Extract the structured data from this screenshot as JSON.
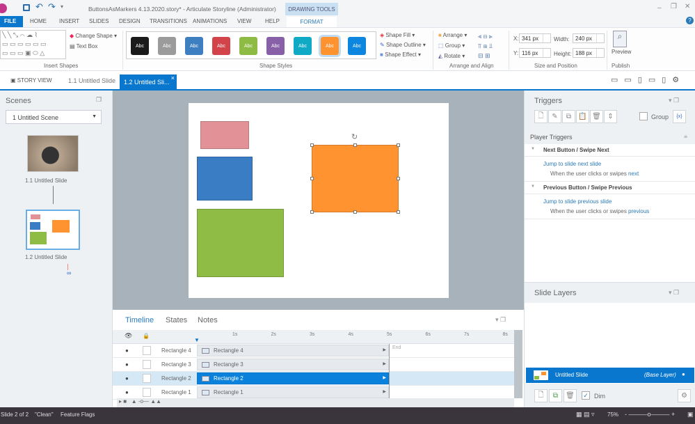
{
  "app": {
    "title": "ButtonsAsMarkers 4.13.2020.story* -  Articulate Storyline (Administrator)",
    "logo": "SL",
    "contextual_group": "DRAWING TOOLS"
  },
  "menu_tabs": [
    "FILE",
    "HOME",
    "INSERT",
    "SLIDES",
    "DESIGN",
    "TRANSITIONS",
    "ANIMATIONS",
    "VIEW",
    "HELP",
    "FORMAT"
  ],
  "ribbon": {
    "insert_shapes": {
      "label": "Insert Shapes",
      "change_shape": "Change Shape",
      "text_box": "Text Box"
    },
    "shape_styles": {
      "label": "Shape Styles",
      "style_text": "Abc",
      "colors": [
        "#1a1a1a",
        "#9b9b9b",
        "#3d7fc1",
        "#d2434a",
        "#8dbb43",
        "#8760a8",
        "#10a9c6",
        "#ff9330",
        "#0d86e0"
      ],
      "selected_index": 7,
      "shape_fill": "Shape Fill",
      "shape_outline": "Shape Outline",
      "shape_effect": "Shape Effect"
    },
    "arrange": {
      "label": "Arrange and Align",
      "arrange": "Arrange",
      "group": "Group",
      "rotate": "Rotate"
    },
    "size_position": {
      "label": "Size and Position",
      "x_label": "X:",
      "x": "341 px",
      "y_label": "Y:",
      "y": "116 px",
      "width_label": "Width:",
      "width": "240 px",
      "height_label": "Height:",
      "height": "188 px"
    },
    "publish": {
      "label": "Publish",
      "preview": "Preview"
    }
  },
  "doc_tabs": {
    "story_view": "STORY VIEW",
    "tabs": [
      "1.1 Untitled Slide",
      "1.2 Untitled Sli..."
    ],
    "active": 1,
    "close": "×"
  },
  "scenes": {
    "title": "Scenes",
    "selected_scene": "1 Untitled Scene",
    "slides": [
      "1.1 Untitled Slide",
      "1.2 Untitled Slide"
    ]
  },
  "slide_shapes": [
    {
      "name": "Rectangle 4",
      "color": "#e29296"
    },
    {
      "name": "Rectangle 3",
      "color": "#3b7dc4"
    },
    {
      "name": "Rectangle 1",
      "color": "#8fbc45"
    },
    {
      "name": "Rectangle 2",
      "color": "#ff9330"
    }
  ],
  "timeline": {
    "tabs": [
      "Timeline",
      "States",
      "Notes"
    ],
    "ticks": [
      "1s",
      "2s",
      "3s",
      "4s",
      "5s",
      "6s",
      "7s",
      "8s"
    ],
    "end_label": "End",
    "rows": [
      {
        "name": "Rectangle 4"
      },
      {
        "name": "Rectangle 3"
      },
      {
        "name": "Rectangle 2",
        "selected": true
      },
      {
        "name": "Rectangle 1"
      }
    ]
  },
  "triggers": {
    "title": "Triggers",
    "group_label": "Group",
    "player_triggers": "Player Triggers",
    "items": [
      {
        "header": "Next Button / Swipe Next",
        "action_prefix": "Jump to slide ",
        "action_target": "next slide",
        "condition_prefix": "When the user clicks or swipes ",
        "condition_target": "next"
      },
      {
        "header": "Previous Button / Swipe Previous",
        "action_prefix": "Jump to slide ",
        "action_target": "previous slide",
        "condition_prefix": "When the user clicks or swipes ",
        "condition_target": "previous"
      }
    ]
  },
  "layers": {
    "title": "Slide Layers",
    "base_name": "Untitled Slide",
    "base_tag": "(Base Layer)",
    "dim_label": "Dim",
    "dim_checked": true
  },
  "status": {
    "slide": "Slide 2 of 2",
    "theme": "\"Clean\"",
    "flags": "Feature Flags",
    "zoom": "75%"
  }
}
